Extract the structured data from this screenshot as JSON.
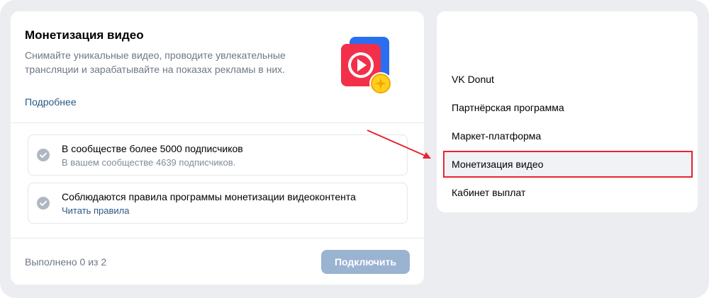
{
  "monetization": {
    "title": "Монетизация видео",
    "description": "Снимайте уникальные видео, проводите увлекательные трансляции и зарабатывайте на показах рекламы в них.",
    "more_link": "Подробнее",
    "illustration_icon": "video-play-coin-icon"
  },
  "requirements": [
    {
      "title": "В сообществе более 5000 подписчиков",
      "subtitle": "В вашем сообществе 4639 подписчиков.",
      "icon": "check-circle-icon"
    },
    {
      "title": "Соблюдаются правила программы монетизации видеоконтента",
      "link": "Читать правила",
      "icon": "check-circle-icon"
    }
  ],
  "footer": {
    "progress_text": "Выполнено 0 из 2",
    "connect_button": "Подключить"
  },
  "side_menu": {
    "items": [
      {
        "label": "VK Donut"
      },
      {
        "label": "Партнёрская программа"
      },
      {
        "label": "Маркет-платформа"
      },
      {
        "label": "Монетизация видео",
        "active": true
      },
      {
        "label": "Кабинет выплат"
      }
    ]
  },
  "colors": {
    "accent_link": "#2a5885",
    "button_disabled": "#9ab3d1",
    "annotation_red": "#e8232f",
    "background": "#ebedf0"
  }
}
